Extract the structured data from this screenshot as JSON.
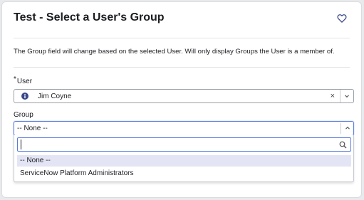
{
  "page": {
    "title": "Test - Select a User's Group",
    "description": "The Group field will change based on the selected User.  Will only display Groups the User is a member of."
  },
  "user_field": {
    "required_marker": "*",
    "label": "User",
    "value": "Jim Coyne",
    "clear_symbol": "×"
  },
  "group_field": {
    "label": "Group",
    "selected": "-- None --",
    "search_value": "",
    "options": [
      "-- None --",
      "ServiceNow Platform Administrators"
    ]
  },
  "colors": {
    "accent": "#5a7be0",
    "highlight": "#e4e5f4",
    "icon": "#3a4a8a"
  },
  "icons": [
    "heart-icon",
    "info-icon",
    "clear-icon",
    "chevron-down-icon",
    "chevron-up-icon",
    "search-icon"
  ]
}
